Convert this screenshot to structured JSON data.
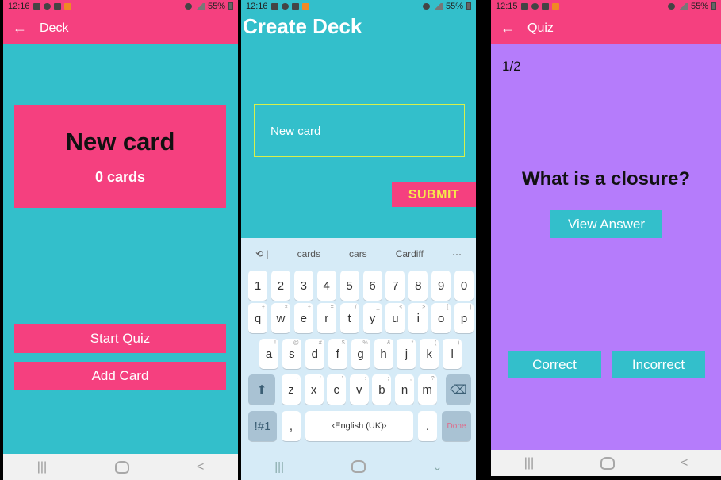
{
  "screens": {
    "deck": {
      "status": {
        "time": "12:16",
        "battery": "55%"
      },
      "appbar": {
        "back_icon": "arrow-left-icon",
        "title": "Deck"
      },
      "deck_card": {
        "title": "New card",
        "count": "0 cards"
      },
      "buttons": {
        "start_quiz": "Start Quiz",
        "add_card": "Add Card"
      },
      "colors": {
        "accent": "#f5407f",
        "background": "#33bfcb"
      }
    },
    "create_deck": {
      "status": {
        "time": "12:16",
        "battery": "55%"
      },
      "title": "Create Deck",
      "input": {
        "value_prefix": "New ",
        "value_underlined": "card"
      },
      "submit_label": "SUBMIT",
      "keyboard": {
        "suggestions": [
          "cards",
          "cars",
          "Cardiff"
        ],
        "more": "···",
        "numbers": [
          "1",
          "2",
          "3",
          "4",
          "5",
          "6",
          "7",
          "8",
          "9",
          "0"
        ],
        "row1": [
          "q",
          "w",
          "e",
          "r",
          "t",
          "y",
          "u",
          "i",
          "o",
          "p"
        ],
        "row1_sub": [
          "+",
          "×",
          "÷",
          "=",
          "/",
          "_",
          "<",
          ">",
          "[",
          "]"
        ],
        "row2": [
          "a",
          "s",
          "d",
          "f",
          "g",
          "h",
          "j",
          "k",
          "l"
        ],
        "row2_sub": [
          "!",
          "@",
          "#",
          "$",
          "%",
          "&",
          "*",
          "(",
          ")"
        ],
        "row3": [
          "z",
          "x",
          "c",
          "v",
          "b",
          "n",
          "m"
        ],
        "row3_sub": [
          "-",
          "'",
          "\"",
          ":",
          ";",
          ",",
          "?"
        ],
        "symbols_key": "!#1",
        "comma": ",",
        "space_label": "English (UK)",
        "period": ".",
        "done_label": "Done"
      }
    },
    "quiz": {
      "status": {
        "time": "12:15",
        "battery": "55%"
      },
      "appbar": {
        "back_icon": "arrow-left-icon",
        "title": "Quiz"
      },
      "progress": "1/2",
      "question": "What is a closure?",
      "view_answer": "View Answer",
      "correct": "Correct",
      "incorrect": "Incorrect",
      "colors": {
        "background": "#b57cfb",
        "button": "#33bfcb"
      }
    }
  }
}
